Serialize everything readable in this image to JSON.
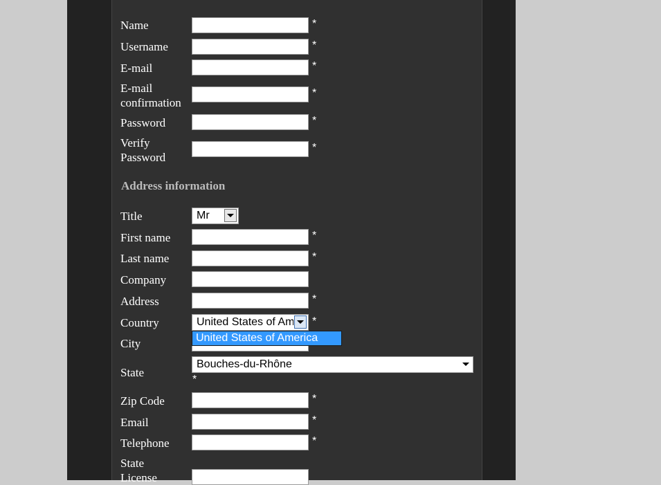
{
  "registration": {
    "name_label": "Name",
    "username_label": "Username",
    "email_label": "E-mail",
    "email_confirm_label_1": "E-mail",
    "email_confirm_label_2": "confirmation",
    "password_label": "Password",
    "verify_password_label_1": "Verify",
    "verify_password_label_2": "Password",
    "required_marker": "*"
  },
  "address": {
    "heading": "Address information",
    "title_label": "Title",
    "title_value": "Mr",
    "first_name_label": "First name",
    "last_name_label": "Last name",
    "company_label": "Company",
    "address_label": "Address",
    "country_label": "Country",
    "country_value": "United States of America",
    "country_options": [
      "United States of America"
    ],
    "city_label": "City",
    "state_label": "State",
    "state_value": "Bouches-du-Rhône",
    "zip_label": "Zip Code",
    "email_label": "Email",
    "telephone_label": "Telephone",
    "state_license_label_1": "State",
    "state_license_label_2": "License"
  },
  "colors": {
    "page_bg": "#cccccc",
    "frame_bg": "#222222",
    "panel_bg": "#303030",
    "highlight": "#3399ff"
  }
}
